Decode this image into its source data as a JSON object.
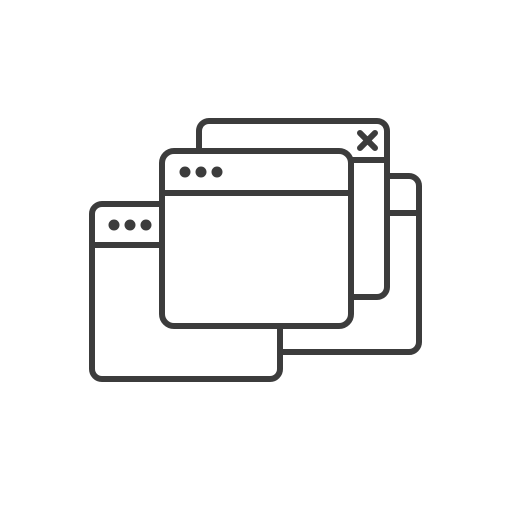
{
  "icon": {
    "name": "multiple-browser-windows-icon",
    "stroke_color": "#3c3c3c",
    "background_color": "#ffffff",
    "windows": [
      {
        "role": "back-left-window",
        "dots": 3
      },
      {
        "role": "back-right-window",
        "dots": 0
      },
      {
        "role": "middle-window-with-close",
        "dots": 0,
        "close_icon": "close-icon"
      },
      {
        "role": "front-window",
        "dots": 3
      }
    ]
  }
}
